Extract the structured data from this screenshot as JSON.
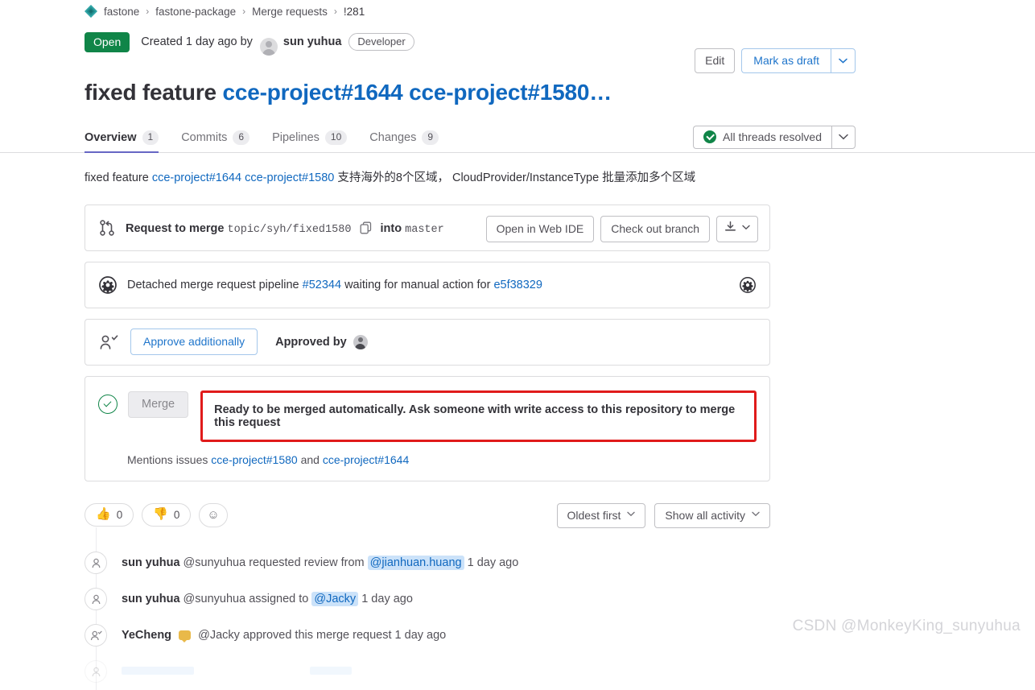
{
  "breadcrumb": {
    "logo_icon": "gitlab-tanuki-diamond-icon",
    "items": [
      {
        "label": "fastone"
      },
      {
        "label": "fastone-package"
      },
      {
        "label": "Merge requests"
      },
      {
        "label": "!281"
      }
    ],
    "separator": "›"
  },
  "status": {
    "state_badge": "Open",
    "created_text": "Created 1 day ago by",
    "author": "sun yuhua",
    "role": "Developer",
    "avatar_icon": "user-avatar-placeholder-icon"
  },
  "top_actions": {
    "edit_label": "Edit",
    "mark_as_draft_label": "Mark as draft",
    "caret_icon": "chevron-down-icon"
  },
  "title": {
    "plain_prefix": "fixed feature ",
    "link_one": "cce-project#1644",
    "link_two": "cce-project#1580…"
  },
  "tabs": [
    {
      "label": "Overview",
      "count": "1",
      "active": true
    },
    {
      "label": "Commits",
      "count": "6",
      "active": false
    },
    {
      "label": "Pipelines",
      "count": "10",
      "active": false
    },
    {
      "label": "Changes",
      "count": "9",
      "active": false
    }
  ],
  "threads_widget": {
    "label": "All threads resolved",
    "status_icon": "check-circle-green-icon",
    "caret_icon": "chevron-down-icon"
  },
  "description": {
    "prefix": "fixed feature ",
    "link_one": "cce-project#1644",
    "link_two": "cce-project#1580",
    "suffix": " 支持海外的8个区域， CloudProvider/InstanceType 批量添加多个区域"
  },
  "merge_branch_widget": {
    "icon": "merge-request-branch-icon",
    "label_prefix": "Request to merge",
    "source_branch": "topic/syh/fixed1580",
    "copy_icon": "copy-to-clipboard-icon",
    "label_into": "into",
    "target_branch": "master",
    "open_web_ide_label": "Open in Web IDE",
    "check_out_branch_label": "Check out branch",
    "download_icon": "download-icon",
    "download_caret_icon": "chevron-down-icon"
  },
  "pipeline_widget": {
    "icon": "pipeline-manual-action-icon",
    "text_prefix": "Detached merge request pipeline",
    "pipeline_id": "#52344",
    "text_middle": "waiting for manual action for",
    "commit_sha": "e5f38329",
    "settings_icon": "gear-icon"
  },
  "approval_widget": {
    "icon": "user-check-icon",
    "approve_button_label": "Approve additionally",
    "approved_by_label": "Approved by",
    "approver_avatar_icon": "approver-avatar-icon"
  },
  "merge_widget": {
    "status_icon": "check-circle-outline-green-icon",
    "merge_button_label": "Merge",
    "ready_message": "Ready to be merged automatically. Ask someone with write access to this repository to merge this request",
    "highlight_color": "#e01b1b",
    "mentions_prefix": "Mentions issues",
    "mentions_link_one": "cce-project#1580",
    "mentions_joiner": "and",
    "mentions_link_two": "cce-project#1644"
  },
  "reactions": [
    {
      "emoji": "👍",
      "icon": "thumbs-up-icon",
      "count": "0"
    },
    {
      "emoji": "👎",
      "icon": "thumbs-down-icon",
      "count": "0"
    }
  ],
  "add_reaction": {
    "emoji": "☺",
    "icon": "add-reaction-smiley-icon"
  },
  "sort_controls": {
    "sort_label": "Oldest first",
    "activity_filter_label": "Show all activity",
    "caret_icon": "chevron-down-icon"
  },
  "activity": [
    {
      "avatar_icon": "user-outline-icon",
      "author": "sun yuhua",
      "handle": "@sunyuhua",
      "action": "requested review from",
      "mention": "@jianhuan.huang",
      "timestamp": "1 day ago",
      "has_speech_icon": false
    },
    {
      "avatar_icon": "user-outline-icon",
      "author": "sun yuhua",
      "handle": "@sunyuhua",
      "action": "assigned to",
      "mention": "@Jacky",
      "timestamp": "1 day ago",
      "has_speech_icon": false
    },
    {
      "avatar_icon": "user-check-outline-icon",
      "author": "YeCheng",
      "handle": "@Jacky",
      "action": "approved this merge request",
      "mention": "",
      "timestamp": "1 day ago",
      "has_speech_icon": true
    }
  ],
  "watermark": "CSDN @MonkeyKing_sunyuhua",
  "colors": {
    "accent_blue": "#1068bf",
    "brand_purple": "#6666c4",
    "success_green": "#108548",
    "alert_red": "#e01b1b",
    "border_gray": "#dcdcde"
  }
}
